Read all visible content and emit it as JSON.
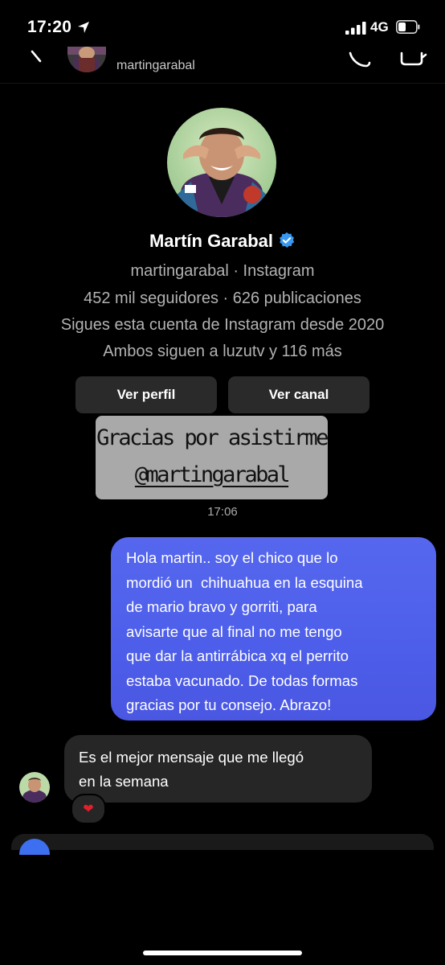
{
  "status_bar": {
    "time": "17:20",
    "network": "4G"
  },
  "header": {
    "username": "martingarabal"
  },
  "profile": {
    "name": "Martín Garabal",
    "handle_line": "martingarabal · Instagram",
    "stats": "452 mil seguidores · 626 publicaciones",
    "following_since": "Sigues esta cuenta de Instagram desde 2020",
    "mutual": "Ambos siguen a luzutv y 116 más",
    "view_profile_label": "Ver perfil",
    "view_channel_label": "Ver canal"
  },
  "story_reply": {
    "line1": "Gracias por asistirme",
    "line2": "@martingarabal",
    "time": "17:06"
  },
  "messages": {
    "outgoing": "Hola martin.. soy el chico que lo\nmordió un  chihuahua en la esquina\nde mario bravo y gorriti, para\navisarte que al final no me tengo\nque dar la antirrábica xq el perrito\nestaba vacunado. De todas formas\ngracias por tu consejo. Abrazo!",
    "incoming": "Es el mejor mensaje que me llegó\nen la semana",
    "reaction": "❤"
  },
  "colors": {
    "background": "#000000",
    "outgoing_bubble": "#5163ec",
    "incoming_bubble": "#262626",
    "button_bg": "#2a2a2a",
    "verified": "#3897f0"
  },
  "icons": [
    "location-arrow-icon",
    "signal-icon",
    "battery-icon",
    "back-icon",
    "phone-icon",
    "video-camera-icon",
    "verified-badge-icon",
    "heart-reaction-icon"
  ]
}
